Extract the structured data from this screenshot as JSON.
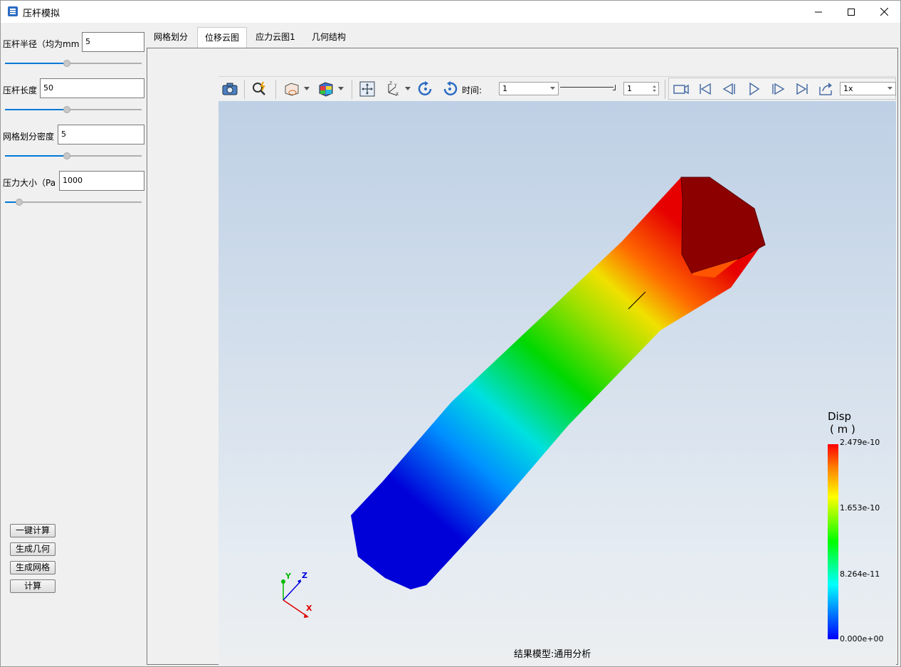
{
  "window": {
    "title": "压杆模拟"
  },
  "sidebar": {
    "params": [
      {
        "label": "压杆半径（均为mm",
        "value": "5",
        "slider": 0.45
      },
      {
        "label": "压杆长度",
        "value": "50",
        "slider": 0.45
      },
      {
        "label": "网格划分密度",
        "value": "5",
        "slider": 0.45
      },
      {
        "label": "压力大小（Pa",
        "value": "1000",
        "slider": 0.08
      }
    ],
    "buttons": [
      "一键计算",
      "生成几何",
      "生成网格",
      "计算"
    ]
  },
  "tabs": [
    {
      "label": "网格划分",
      "active": false
    },
    {
      "label": "位移云图",
      "active": true
    },
    {
      "label": "应力云图1",
      "active": false
    },
    {
      "label": "几何结构",
      "active": false
    }
  ],
  "toolbar": {
    "time_label": "时间:",
    "time_value": "1",
    "frame_value": "1",
    "speed_value": "1x"
  },
  "legend": {
    "title": "Disp",
    "unit": "( m )",
    "labels": [
      "2.479e-10",
      "1.653e-10",
      "8.264e-11",
      "0.000e+00"
    ],
    "colors": [
      "#ff0000",
      "#ffff00",
      "#00ff00",
      "#00ffff",
      "#0000ff"
    ]
  },
  "axes": {
    "x": "X",
    "y": "Y",
    "z": "Z"
  },
  "status": {
    "text": "结果模型:通用分析"
  }
}
